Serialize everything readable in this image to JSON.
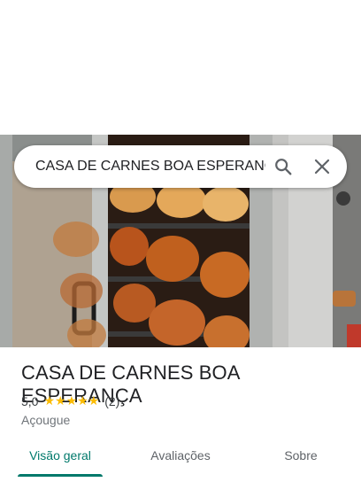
{
  "search": {
    "query": "CASA DE CARNES BOA ESPERANÇA"
  },
  "place": {
    "name": "CASA DE CARNES BOA ESPERANÇA",
    "rating": "5,0",
    "stars": "★★★★★",
    "reviews_count": "(2)",
    "category": "Açougue"
  },
  "tabs": [
    {
      "label": "Visão geral",
      "active": true
    },
    {
      "label": "Avaliações",
      "active": false
    },
    {
      "label": "Sobre",
      "active": false
    }
  ],
  "colors": {
    "accent": "#00796b",
    "star": "#fbbc04"
  },
  "photo": {
    "subject": "rotisserie-chickens"
  }
}
